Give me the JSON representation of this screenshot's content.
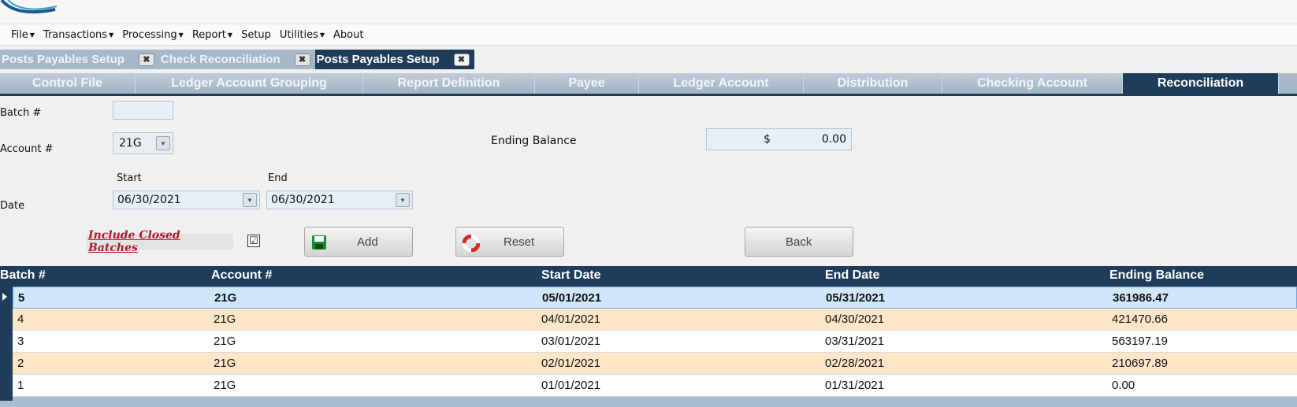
{
  "menu": {
    "items": [
      {
        "label": "File",
        "has_arrow": true
      },
      {
        "label": "Transactions",
        "has_arrow": true
      },
      {
        "label": "Processing",
        "has_arrow": true
      },
      {
        "label": "Report",
        "has_arrow": true
      },
      {
        "label": "Setup",
        "has_arrow": false
      },
      {
        "label": "Utilities",
        "has_arrow": true
      },
      {
        "label": "About",
        "has_arrow": false
      }
    ]
  },
  "doc_tabs": [
    {
      "label": "Posts Payables Setup",
      "active": false
    },
    {
      "label": "Check Reconciliation",
      "active": false
    },
    {
      "label": "Posts Payables Setup",
      "active": true
    }
  ],
  "section_tabs": [
    {
      "label": "Control File",
      "active": false
    },
    {
      "label": "Ledger Account Grouping",
      "active": false
    },
    {
      "label": "Report Definition",
      "active": false
    },
    {
      "label": "Payee",
      "active": false
    },
    {
      "label": "Ledger Account",
      "active": false
    },
    {
      "label": "Distribution",
      "active": false
    },
    {
      "label": "Checking Account",
      "active": false
    },
    {
      "label": "Reconciliation",
      "active": true
    }
  ],
  "form": {
    "batch_label": "Batch #",
    "batch_value": "",
    "account_label": "Account #",
    "account_value": "21G",
    "ending_balance_label": "Ending Balance",
    "ending_balance_currency": "$",
    "ending_balance_value": "0.00",
    "start_label": "Start",
    "end_label": "End",
    "date_label": "Date",
    "start_date": "06/30/2021",
    "end_date": "06/30/2021",
    "include_closed_label": "Include Closed Batches",
    "include_closed_checked": "☑",
    "add_label": "Add",
    "reset_label": "Reset",
    "back_label": "Back"
  },
  "grid": {
    "columns": [
      "Batch #",
      "Account #",
      "Start Date",
      "End Date",
      "Ending Balance"
    ],
    "rows": [
      {
        "batch": "5",
        "account": "21G",
        "start": "05/01/2021",
        "end": "05/31/2021",
        "balance": "361986.47",
        "selected": true
      },
      {
        "batch": "4",
        "account": "21G",
        "start": "04/01/2021",
        "end": "04/30/2021",
        "balance": "421470.66",
        "selected": false
      },
      {
        "batch": "3",
        "account": "21G",
        "start": "03/01/2021",
        "end": "03/31/2021",
        "balance": "563197.19",
        "selected": false
      },
      {
        "batch": "2",
        "account": "21G",
        "start": "02/01/2021",
        "end": "02/28/2021",
        "balance": "210697.89",
        "selected": false
      },
      {
        "batch": "1",
        "account": "21G",
        "start": "01/01/2021",
        "end": "01/31/2021",
        "balance": "0.00",
        "selected": false
      }
    ]
  },
  "icons": {
    "add": "save-disk-icon",
    "reset": "reset-lifebuoy-icon",
    "close": "close-x-icon",
    "dropdown": "dropdown-arrow-icon"
  },
  "colors": {
    "navy": "#1f3c5a",
    "tab_inactive": "#a5b7c8",
    "row_alt": "#fde6c8",
    "row_selected": "#cfe6fb",
    "include_label": "#b0172b"
  }
}
